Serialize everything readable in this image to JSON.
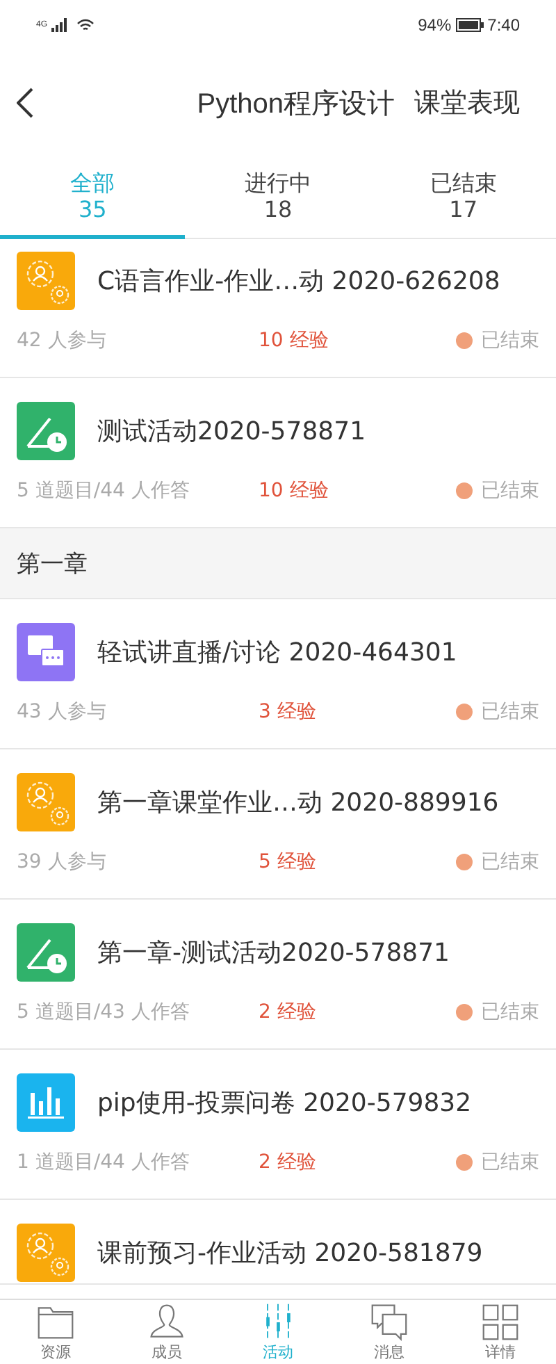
{
  "status_bar": {
    "network": "4G",
    "battery": "94%",
    "time": "7:40"
  },
  "header": {
    "title": "Python程序设计",
    "action": "课堂表现"
  },
  "tabs": [
    {
      "label": "全部",
      "count": "35",
      "selected": true
    },
    {
      "label": "进行中",
      "count": "18",
      "selected": false
    },
    {
      "label": "已结束",
      "count": "17",
      "selected": false
    }
  ],
  "list": [
    {
      "kind": "homework",
      "title": "C语言作业-作业…动 2020-626208",
      "stats": "42 人参与",
      "exp": "10 经验",
      "status": "已结束"
    },
    {
      "kind": "test",
      "title": "测试活动2020-578871",
      "stats": "5 道题目/44 人作答",
      "exp": "10 经验",
      "status": "已结束"
    },
    {
      "kind": "section",
      "title": "第一章"
    },
    {
      "kind": "discussion",
      "title": "轻试讲直播/讨论 2020-464301",
      "stats": "43 人参与",
      "exp": "3 经验",
      "status": "已结束"
    },
    {
      "kind": "homework",
      "title": "第一章课堂作业…动 2020-889916",
      "stats": "39 人参与",
      "exp": "5 经验",
      "status": "已结束"
    },
    {
      "kind": "test",
      "title": "第一章-测试活动2020-578871",
      "stats": "5 道题目/43 人作答",
      "exp": "2 经验",
      "status": "已结束"
    },
    {
      "kind": "vote",
      "title": "pip使用-投票问卷 2020-579832",
      "stats": "1 道题目/44 人作答",
      "exp": "2 经验",
      "status": "已结束"
    },
    {
      "kind": "homework",
      "title": "课前预习-作业活动 2020-581879"
    }
  ],
  "nav": [
    {
      "label": "资源",
      "selected": false
    },
    {
      "label": "成员",
      "selected": false
    },
    {
      "label": "活动",
      "selected": true
    },
    {
      "label": "消息",
      "selected": false
    },
    {
      "label": "详情",
      "selected": false
    }
  ]
}
